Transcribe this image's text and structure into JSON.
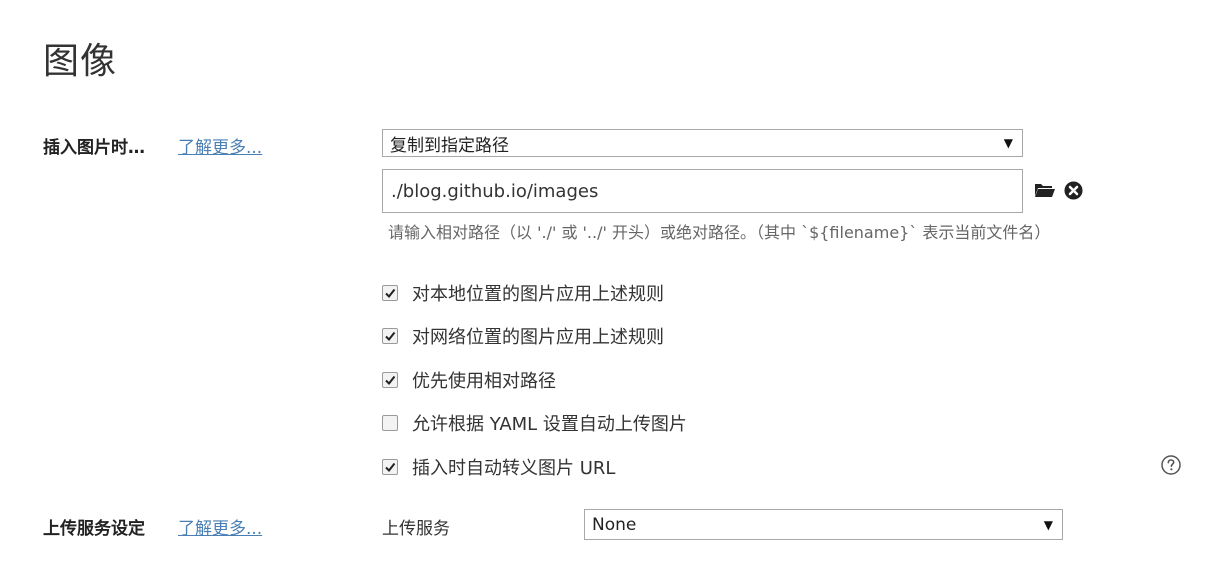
{
  "page": {
    "title": "图像"
  },
  "insert_image": {
    "label": "插入图片时…",
    "learn_more": "了解更多...",
    "action_select": "复制到指定路径",
    "path_value": "./blog.github.io/images",
    "hint": "请输入相对路径（以 './' 或 '../' 开头）或绝对路径。（其中 `${filename}` 表示当前文件名）",
    "options": [
      {
        "label": "对本地位置的图片应用上述规则",
        "checked": true
      },
      {
        "label": "对网络位置的图片应用上述规则",
        "checked": true
      },
      {
        "label": "优先使用相对路径",
        "checked": true
      },
      {
        "label": "允许根据 YAML 设置自动上传图片",
        "checked": false
      },
      {
        "label": "插入时自动转义图片 URL",
        "checked": true
      }
    ]
  },
  "upload": {
    "label": "上传服务设定",
    "learn_more": "了解更多...",
    "service_label": "上传服务",
    "service_select": "None"
  },
  "icons": {
    "select_arrow": "▼",
    "folder": "folder-icon",
    "clear": "close-circle-icon",
    "help": "help-circle-icon",
    "check": "checkmark-icon"
  }
}
